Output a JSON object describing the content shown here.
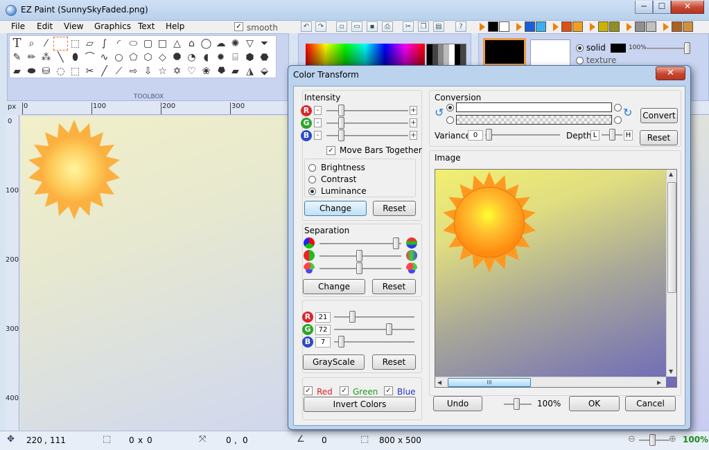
{
  "window": {
    "title": "EZ Paint (SunnySkyFaded.png)",
    "controls": {
      "minimize": "─",
      "maximize": "☐",
      "close": "✕"
    }
  },
  "menu": [
    "File",
    "Edit",
    "View",
    "Graphics",
    "Text",
    "Help"
  ],
  "toolbar": {
    "smooth_label": "smooth",
    "smooth_checked": true
  },
  "toolbox": {
    "caption": "TOOLBOX"
  },
  "color_panel": {
    "fill_solid": "solid",
    "fill_texture": "texture",
    "opacity": "100%"
  },
  "rulers": {
    "unit": "px",
    "top_ticks": [
      "0",
      "100",
      "200",
      "300"
    ],
    "left_ticks": [
      "0",
      "100",
      "200",
      "300",
      "400"
    ]
  },
  "status": {
    "cursor_x": "220",
    "cursor_y": "111",
    "selection_w": "0",
    "selection_x": "x",
    "selection_h": "0",
    "offset_x": "0",
    "offset_sep": ",",
    "offset_y": "0",
    "angle": "0",
    "image_w": "800",
    "image_x": "x",
    "image_h": "500",
    "zoom": "100%",
    "coord_sep": ","
  },
  "dialog": {
    "title": "Color Transform",
    "intensity": {
      "label": "Intensity",
      "channels": [
        {
          "key": "R",
          "minus": "-",
          "plus": "+",
          "color": "#d9262c"
        },
        {
          "key": "G",
          "minus": "-",
          "plus": "+",
          "color": "#2aa52a"
        },
        {
          "key": "B",
          "minus": "-",
          "plus": "+",
          "color": "#2d49c8"
        }
      ],
      "move_together_label": "Move Bars Together",
      "move_together_checked": true,
      "modes": [
        "Brightness",
        "Contrast",
        "Luminance"
      ],
      "selected_mode": "Luminance",
      "change_button": "Change",
      "reset_button": "Reset"
    },
    "separation": {
      "label": "Separation",
      "change_button": "Change",
      "reset_button": "Reset"
    },
    "grayscale": {
      "channels": [
        {
          "key": "R",
          "value": "21",
          "color": "#d9262c"
        },
        {
          "key": "G",
          "value": "72",
          "color": "#2aa52a"
        },
        {
          "key": "B",
          "value": "7",
          "color": "#2d49c8"
        }
      ],
      "button": "GrayScale",
      "reset_button": "Reset"
    },
    "invert": {
      "red": "Red",
      "green": "Green",
      "blue": "Blue",
      "red_checked": true,
      "green_checked": true,
      "blue_checked": true,
      "button": "Invert Colors"
    },
    "conversion": {
      "label": "Conversion",
      "convert_button": "Convert",
      "reset_button": "Reset",
      "variance_label": "Variance",
      "variance_value": "0",
      "depth_label": "Depth",
      "depth_low": "L",
      "depth_high": "H"
    },
    "image": {
      "label": "Image",
      "scrollbar_grip": "III"
    },
    "footer": {
      "undo_button": "Undo",
      "zoom": "100%",
      "ok_button": "OK",
      "cancel_button": "Cancel"
    }
  }
}
